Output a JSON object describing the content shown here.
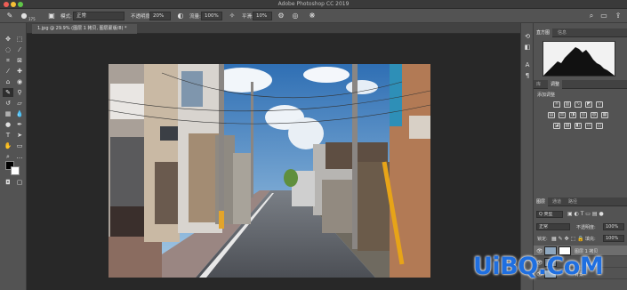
{
  "app": {
    "window_title": "Adobe Photoshop CC 2019"
  },
  "traffic_lights": [
    "#ee5e56",
    "#f5bf36",
    "#5fc648"
  ],
  "options_bar": {
    "mode_label": "模式:",
    "mode_value": "正常",
    "opacity_label": "不透明度:",
    "opacity_value": "20%",
    "flow_label": "流量:",
    "flow_value": "100%",
    "smoothing_label": "平滑:",
    "smoothing_value": "10%",
    "brush_size": "175"
  },
  "document": {
    "tab_label": "1.jpg @ 29.9% (图层 1 拷贝, 图层蒙版/8) *"
  },
  "histogram_panel": {
    "tabs": [
      "直方图",
      "信息"
    ]
  },
  "adjustments_panel": {
    "tabs": [
      "库",
      "调整"
    ],
    "heading": "添加调整"
  },
  "layers_panel": {
    "tabs": [
      "图层",
      "通道",
      "路径"
    ],
    "filter_label": "Q 类型",
    "blend_mode": "正常",
    "opacity_label": "不透明度:",
    "opacity_value": "100%",
    "lock_label": "锁定:",
    "fill_label": "填充:",
    "fill_value": "100%",
    "layers": [
      {
        "name": "图层 1 拷贝"
      },
      {
        "name": ""
      },
      {
        "name": "背景"
      }
    ]
  },
  "watermark": {
    "text": "UiBQ.CoM"
  },
  "icons": {
    "options": [
      "brush-icon",
      "brush-preset-icon",
      "brush-panel-icon",
      "pressure-opacity-icon",
      "airbrush-icon",
      "angle-icon",
      "pressure-size-icon",
      "symmetry-icon"
    ],
    "top_right": [
      "search-icon",
      "workspace-icon",
      "share-icon"
    ]
  }
}
